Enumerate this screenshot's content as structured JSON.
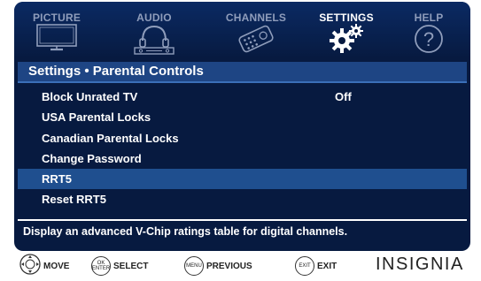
{
  "tabs": [
    {
      "label": "PICTURE",
      "icon": "tv-icon",
      "active": false
    },
    {
      "label": "AUDIO",
      "icon": "speaker-icon",
      "active": false
    },
    {
      "label": "CHANNELS",
      "icon": "satellite-icon",
      "active": false
    },
    {
      "label": "SETTINGS",
      "icon": "gears-icon",
      "active": true
    },
    {
      "label": "HELP",
      "icon": "question-icon",
      "active": false
    }
  ],
  "header": {
    "title": "Settings • Parental Controls"
  },
  "menu": [
    {
      "label": "Block Unrated TV",
      "value": "Off",
      "selected": false
    },
    {
      "label": "USA Parental Locks",
      "value": "",
      "selected": false
    },
    {
      "label": "Canadian Parental Locks",
      "value": "",
      "selected": false
    },
    {
      "label": "Change Password",
      "value": "",
      "selected": false
    },
    {
      "label": "RRT5",
      "value": "",
      "selected": true
    },
    {
      "label": "Reset RRT5",
      "value": "",
      "selected": false
    }
  ],
  "help_text": "Display an advanced V-Chip ratings table for digital channels.",
  "footer": {
    "move": {
      "label": "MOVE",
      "icon": "dpad-icon"
    },
    "select": {
      "label": "SELECT",
      "key_top": "OK",
      "key_bottom": "ENTER"
    },
    "previous": {
      "label": "PREVIOUS",
      "key": "MENU"
    },
    "exit": {
      "label": "EXIT",
      "key": "EXIT"
    },
    "brand": "INSIGNIA"
  },
  "colors": {
    "background": "#071a40",
    "header": "#1e4584",
    "selected_row": "#1f4f8f",
    "tab_inactive": "#8f9dbb",
    "text": "#ffffff"
  }
}
